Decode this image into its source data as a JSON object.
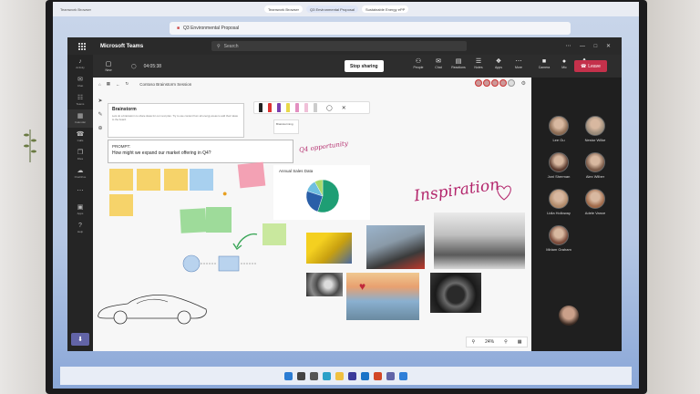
{
  "browser": {
    "tabs": [
      "Teamwork Browser",
      "Q3 Environmental Proposal",
      "Sustainable Energy ePP"
    ],
    "address": "Q3 Environmental Proposal"
  },
  "teams": {
    "app_name": "Microsoft Teams",
    "search_placeholder": "Search",
    "rail": [
      {
        "icon": "bell-icon",
        "glyph": "♪",
        "label": "Activity"
      },
      {
        "icon": "chat-icon",
        "glyph": "✉",
        "label": "Chat"
      },
      {
        "icon": "teams-icon",
        "glyph": "☷",
        "label": "Teams"
      },
      {
        "icon": "calendar-icon",
        "glyph": "▦",
        "label": "Calendar"
      },
      {
        "icon": "phone-icon",
        "glyph": "☎",
        "label": "Calls"
      },
      {
        "icon": "files-icon",
        "glyph": "❐",
        "label": "Files"
      },
      {
        "icon": "onedrive-icon",
        "glyph": "☁",
        "label": "OneDrive"
      },
      {
        "icon": "more-icon",
        "glyph": "⋯",
        "label": ""
      },
      {
        "icon": "apps-icon",
        "glyph": "▣",
        "label": "Apps"
      },
      {
        "icon": "help-icon",
        "glyph": "?",
        "label": "Help"
      }
    ],
    "meeting": {
      "new_label": "New",
      "timer": "04:05:38",
      "stop_sharing": "Stop sharing",
      "controls": [
        {
          "icon": "people-icon",
          "glyph": "⚇",
          "label": "People"
        },
        {
          "icon": "chat-icon",
          "glyph": "✉",
          "label": "Chat"
        },
        {
          "icon": "breakout-icon",
          "glyph": "▤",
          "label": "Reactions"
        },
        {
          "icon": "notes-icon",
          "glyph": "☰",
          "label": "Notes"
        },
        {
          "icon": "apps-icon",
          "glyph": "❖",
          "label": "Apps"
        },
        {
          "icon": "more-icon",
          "glyph": "⋯",
          "label": "More"
        },
        {
          "icon": "camera-icon",
          "glyph": "■",
          "label": "Camera"
        },
        {
          "icon": "mic-icon",
          "glyph": "●",
          "label": "Mic"
        },
        {
          "icon": "share-icon",
          "glyph": "⬆",
          "label": "Share"
        }
      ],
      "leave": "Leave"
    }
  },
  "whiteboard": {
    "title": "Contoso Brainstorm Session",
    "brainstorm_title": "Brainstorm",
    "brainstorm_body": "Lets do a brainstorm to share ideas for our next plan. Try to use content from all energy areas to add their ideas to the board.",
    "brainstorm_side": "Brainstorming",
    "prompt_label": "PROMPT:",
    "prompt_question": "How might we expand our market offering in Q4?",
    "opportunity": "Q4 opportunity",
    "chart_title": "Annual Sales Data",
    "inspiration": "Inspiration",
    "zoom": "24%"
  },
  "chart_data": {
    "type": "pie",
    "title": "Annual Sales Data",
    "values": [
      55,
      25,
      12,
      8
    ],
    "colors": [
      "#1e9e74",
      "#2a5fa8",
      "#6fbfe0",
      "#a8d96a"
    ]
  },
  "participants": [
    {
      "name": "Lee Gu",
      "color": "#8a6a52"
    },
    {
      "name": "Nestor Wilke",
      "color": "#9a8b7a"
    },
    {
      "name": "Joni Sherman",
      "color": "#5a3a2e"
    },
    {
      "name": "Alex Wilber",
      "color": "#7a5a48"
    },
    {
      "name": "Lidia Holloway",
      "color": "#b08a6a"
    },
    {
      "name": "Adele Vance",
      "color": "#a06a4a"
    },
    {
      "name": "Miriam Graham",
      "color": "#7a4a3a"
    }
  ]
}
